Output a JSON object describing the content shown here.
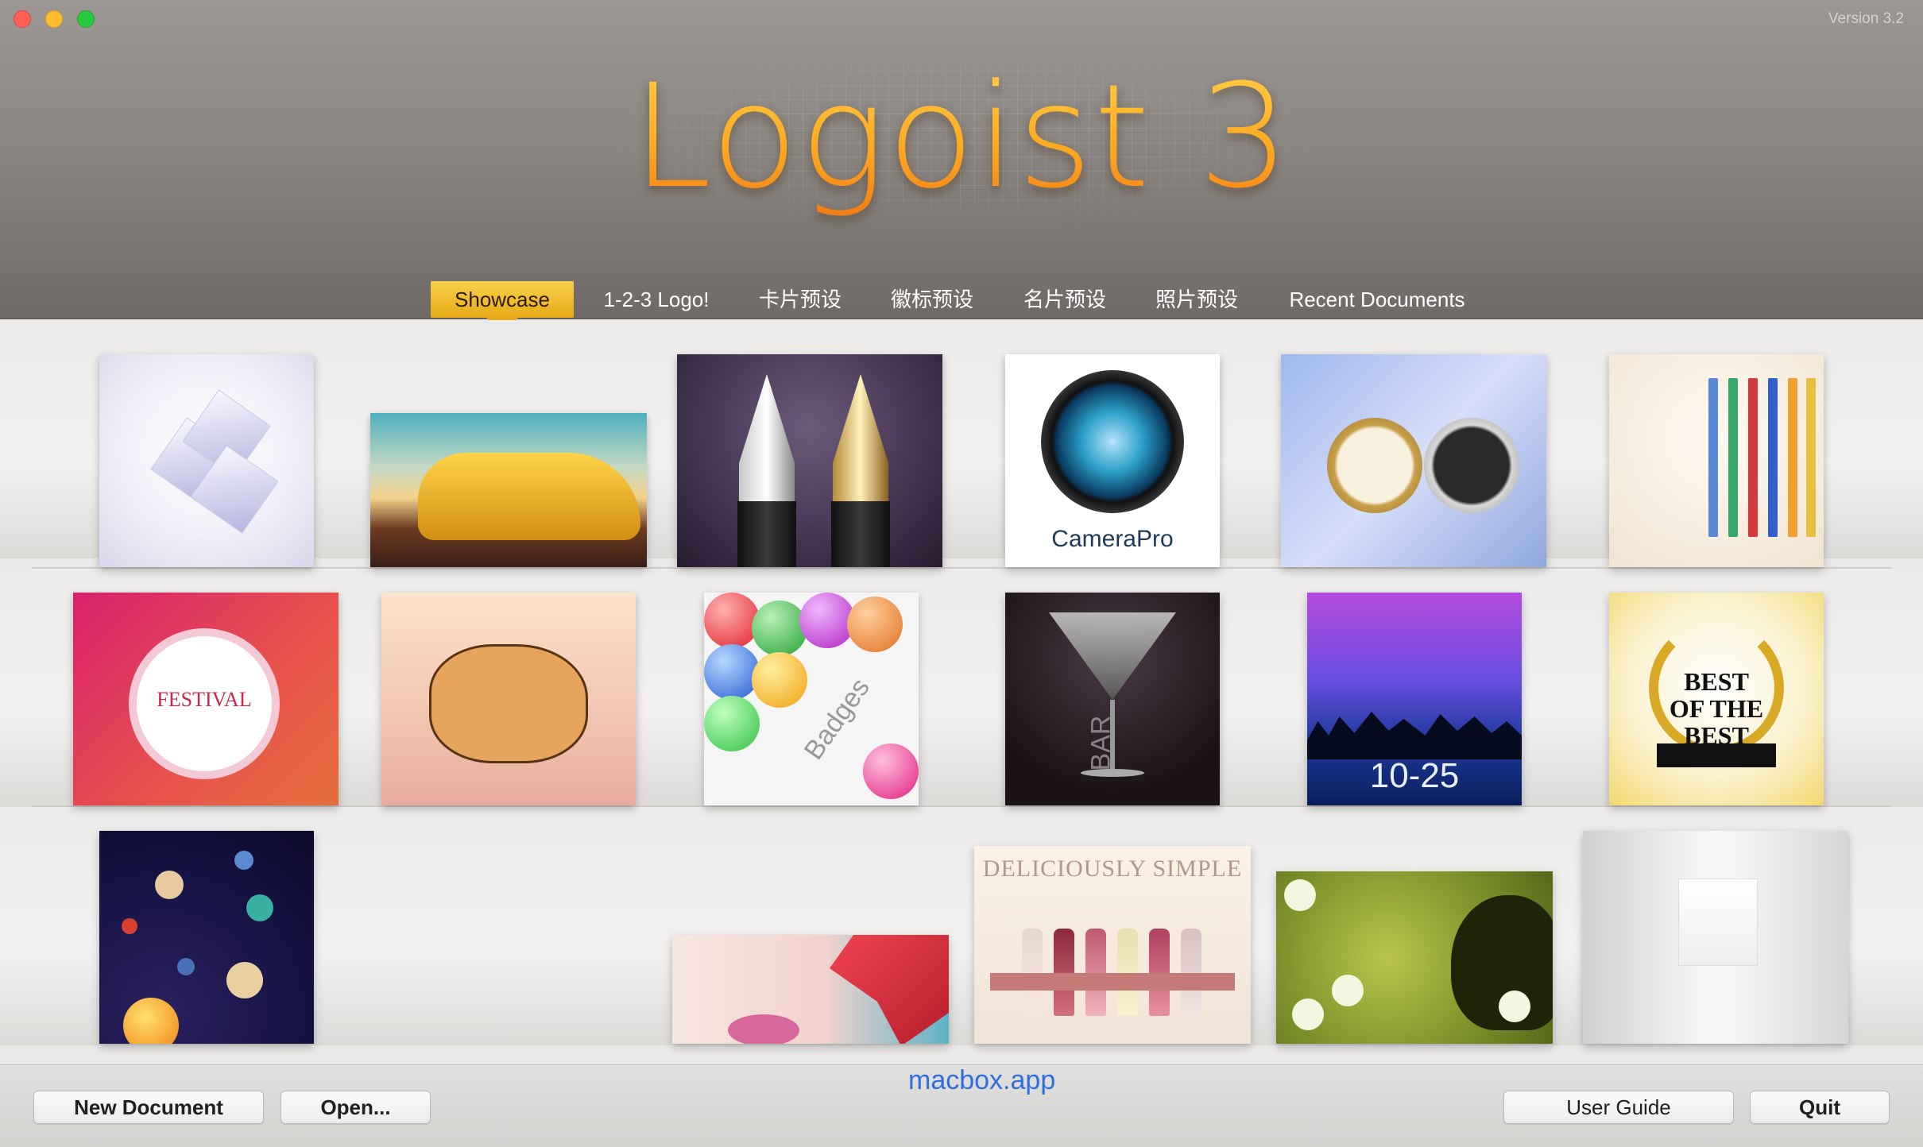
{
  "window": {
    "version": "Version 3.2"
  },
  "header": {
    "app_title": "Logoist 3"
  },
  "tabs": [
    {
      "label": "Showcase",
      "active": true
    },
    {
      "label": "1-2-3 Logo!",
      "active": false
    },
    {
      "label": "卡片预设",
      "active": false
    },
    {
      "label": "徽标预设",
      "active": false
    },
    {
      "label": "名片预设",
      "active": false
    },
    {
      "label": "照片预设",
      "active": false
    },
    {
      "label": "Recent Documents",
      "active": false
    }
  ],
  "showcase": {
    "thumbnails": {
      "camera_text": "CameraPro",
      "festival_text": "FESTIVAL",
      "badges_text": "Badges",
      "bar_text": "BAR",
      "concert_text": "10-25",
      "best_text": "BEST\nOF THE\nBEST",
      "wine_text": "DELICIOUSLY SIMPLE"
    }
  },
  "watermark": "macbox.app",
  "footer": {
    "new_document": "New Document",
    "open": "Open...",
    "user_guide": "User Guide",
    "quit": "Quit"
  },
  "colors": {
    "accent_tab": "#f2c232",
    "traffic_close": "#fe5f57",
    "traffic_min": "#febc2e",
    "traffic_max": "#28c840",
    "watermark": "#2e6ee0"
  }
}
